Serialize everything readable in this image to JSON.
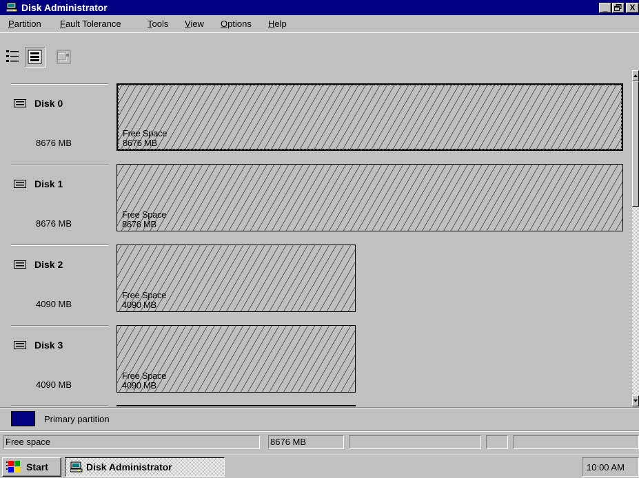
{
  "window": {
    "title": "Disk Administrator",
    "minimize_label": "_",
    "maximize_label": "И",
    "close_label": "X"
  },
  "menu": [
    {
      "underline": "P",
      "rest": "artition"
    },
    {
      "underline": "F",
      "rest": "ault Tolerance"
    },
    {
      "underline": "T",
      "rest": "ools"
    },
    {
      "underline": "V",
      "rest": "iew"
    },
    {
      "underline": "O",
      "rest": "ptions"
    },
    {
      "underline": "H",
      "rest": "elp"
    }
  ],
  "toolbar": {
    "buttons": [
      "volumes-view-icon",
      "disk-configuration-view-icon",
      "properties-icon"
    ]
  },
  "disks": [
    {
      "name": "Disk 0",
      "size": "8676 MB",
      "region_label": "Free Space",
      "region_size": "8676 MB",
      "selected": true
    },
    {
      "name": "Disk 1",
      "size": "8676 MB",
      "region_label": "Free Space",
      "region_size": "8676 MB",
      "selected": false
    },
    {
      "name": "Disk 2",
      "size": "4090 MB",
      "region_label": "Free Space",
      "region_size": "4090 MB",
      "selected": false
    },
    {
      "name": "Disk 3",
      "size": "4090 MB",
      "region_label": "Free Space",
      "region_size": "4090 MB",
      "selected": false
    }
  ],
  "legend": {
    "label": "Primary partition",
    "color": "#000080"
  },
  "status_bar": {
    "type": "Free space",
    "size": "8676 MB",
    "panel3": "",
    "panel4": "",
    "panel5": ""
  },
  "taskbar": {
    "start_label": "Start",
    "task_label": "Disk Administrator",
    "clock": "10:00 AM"
  },
  "colors": {
    "title_bar": "#000080",
    "face": "#c0c0c0"
  }
}
